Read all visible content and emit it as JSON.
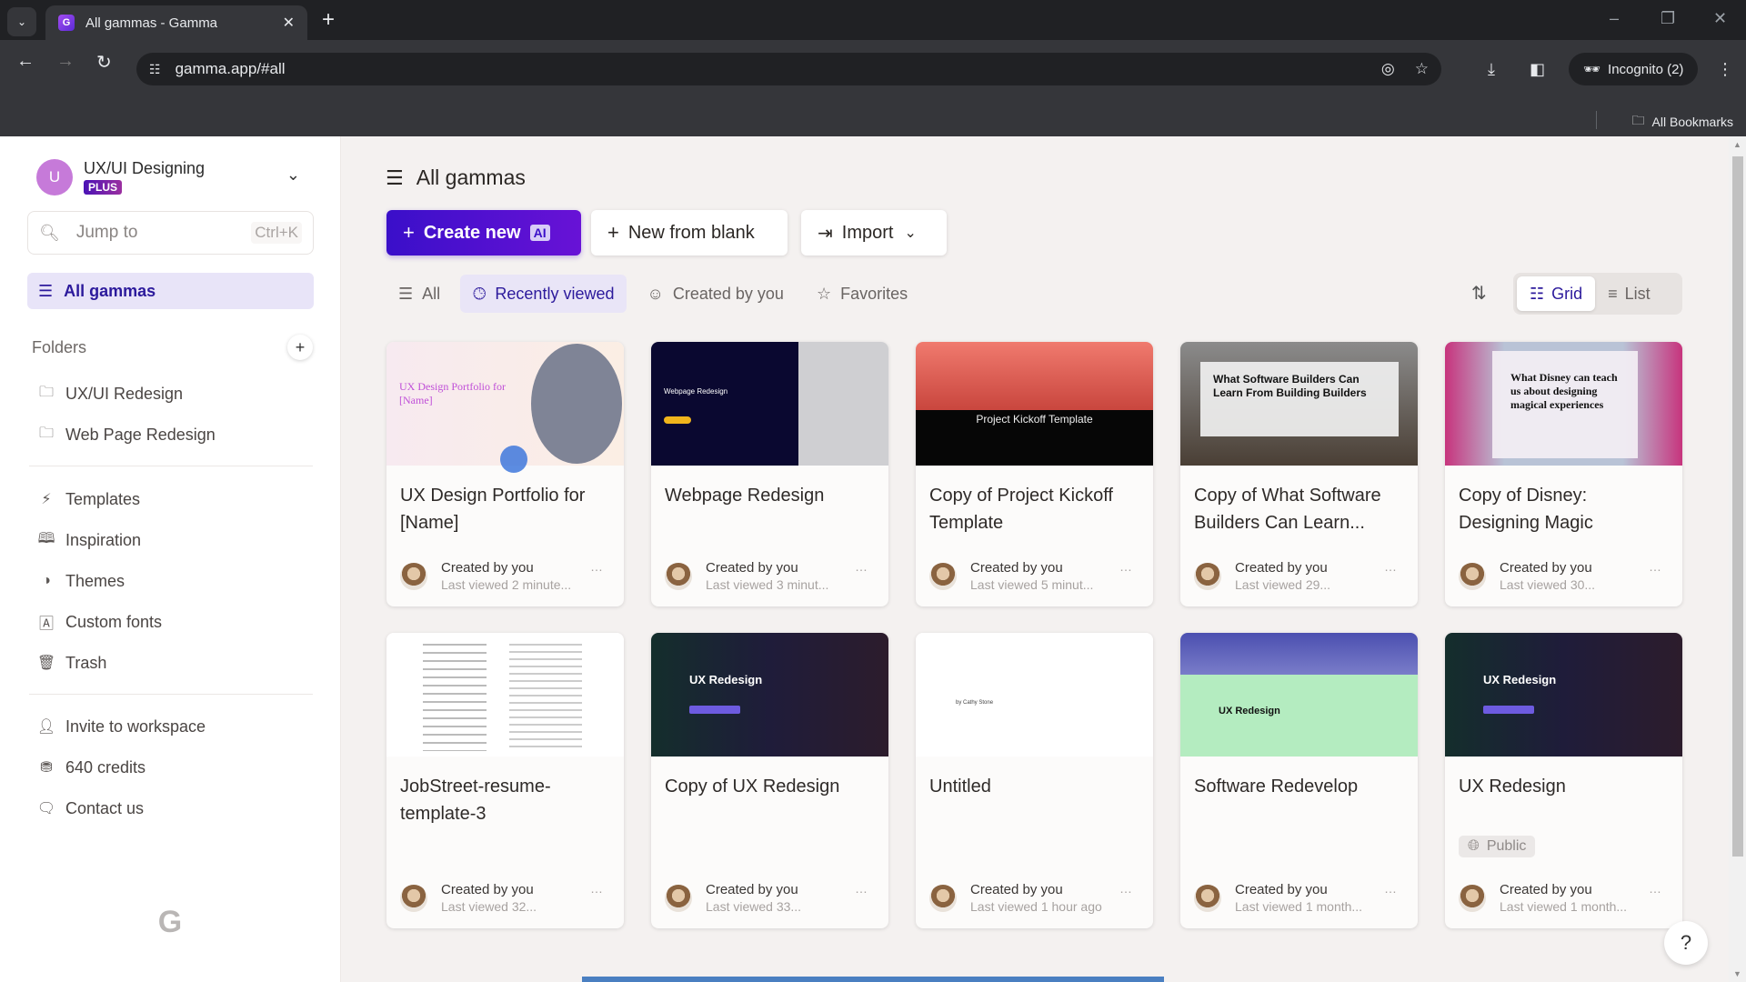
{
  "browser": {
    "tab_title": "All gammas - Gamma",
    "url": "gamma.app/#all",
    "incognito_label": "Incognito (2)",
    "bookmarks_label": "All Bookmarks"
  },
  "sidebar": {
    "workspace_name": "UX/UI Designing",
    "workspace_initial": "U",
    "plan_badge": "PLUS",
    "search_placeholder": "Jump to",
    "search_shortcut": "Ctrl+K",
    "all_gammas": "All gammas",
    "folders_header": "Folders",
    "folders": [
      {
        "label": "UX/UI Redesign",
        "icon": "folder-icon"
      },
      {
        "label": "Web Page Redesign",
        "icon": "folder-icon"
      }
    ],
    "nav": [
      {
        "label": "Templates",
        "icon": "templates-icon"
      },
      {
        "label": "Inspiration",
        "icon": "book-icon"
      },
      {
        "label": "Themes",
        "icon": "palette-icon"
      },
      {
        "label": "Custom fonts",
        "icon": "font-icon"
      },
      {
        "label": "Trash",
        "icon": "trash-icon"
      }
    ],
    "footer": [
      {
        "label": "Invite to workspace",
        "icon": "invite-user-icon"
      },
      {
        "label": "640 credits",
        "icon": "credits-icon"
      },
      {
        "label": "Contact us",
        "icon": "chat-icon"
      }
    ]
  },
  "main": {
    "title": "All gammas",
    "create_new": "Create new",
    "ai_badge": "AI",
    "new_from_blank": "New from blank",
    "import": "Import",
    "filters": [
      {
        "label": "All",
        "active": false
      },
      {
        "label": "Recently viewed",
        "active": true
      },
      {
        "label": "Created by you",
        "active": false
      },
      {
        "label": "Favorites",
        "active": false
      }
    ],
    "view_grid": "Grid",
    "view_list": "List",
    "cards": [
      {
        "title": "UX Design Portfolio for [Name]",
        "created": "Created by you",
        "viewed": "Last viewed 2 minute...",
        "thumb_text": "UX Design Portfolio for [Name]"
      },
      {
        "title": "Webpage Redesign",
        "created": "Created by you",
        "viewed": "Last viewed 3 minut...",
        "thumb_text": "Webpage Redesign"
      },
      {
        "title": "Copy of Project Kickoff Template",
        "created": "Created by you",
        "viewed": "Last viewed 5 minut...",
        "thumb_text": "Project Kickoff Template"
      },
      {
        "title": "Copy of What Software Builders Can Learn...",
        "created": "Created by you",
        "viewed": "Last viewed 29...",
        "thumb_text": "What Software Builders Can Learn From Building Builders"
      },
      {
        "title": "Copy of Disney: Designing Magic",
        "created": "Created by you",
        "viewed": "Last viewed 30...",
        "thumb_text": "What Disney can teach us about designing magical experiences"
      },
      {
        "title": "JobStreet-resume-template-3",
        "created": "Created by you",
        "viewed": "Last viewed 32...",
        "thumb_text": ""
      },
      {
        "title": "Copy of UX Redesign",
        "created": "Created by you",
        "viewed": "Last viewed 33...",
        "thumb_text": "UX Redesign"
      },
      {
        "title": "Untitled",
        "created": "Created by you",
        "viewed": "Last viewed 1 hour ago",
        "thumb_text": "by Cathy Stone"
      },
      {
        "title": "Software Redevelop",
        "created": "Created by you",
        "viewed": "Last viewed 1 month...",
        "thumb_text": "UX Redesign"
      },
      {
        "title": "UX Redesign",
        "created": "Created by you",
        "viewed": "Last viewed 1 month...",
        "thumb_text": "UX Redesign",
        "badge": "Public"
      }
    ],
    "help_label": "?"
  }
}
